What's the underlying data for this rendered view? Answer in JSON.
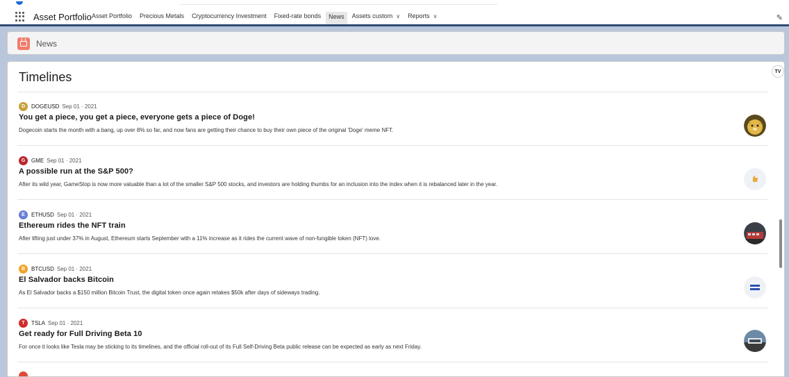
{
  "app": {
    "name": "Asset Portfolio",
    "nav_items": [
      {
        "label": "Asset Portfolio",
        "active": false,
        "dropdown": false
      },
      {
        "label": "Precious Metals",
        "active": false,
        "dropdown": false
      },
      {
        "label": "Cryptocurrency Investment",
        "active": false,
        "dropdown": false
      },
      {
        "label": "Fixed-rate bonds",
        "active": false,
        "dropdown": false
      },
      {
        "label": "News",
        "active": true,
        "dropdown": false
      },
      {
        "label": "Assets custom",
        "active": false,
        "dropdown": true
      },
      {
        "label": "Reports",
        "active": false,
        "dropdown": true
      }
    ]
  },
  "page_header": {
    "title": "News",
    "icon": "tv-icon"
  },
  "feed": {
    "title": "Timelines",
    "logo_text": "TV",
    "items": [
      {
        "symbol": "DOGEUSD",
        "date": "Sep 01 · 2021",
        "icon_letter": "D",
        "icon_color": "#c8a03a",
        "headline": "You get a piece, you get a piece, everyone gets a piece of Doge!",
        "summary": "Dogecoin starts the month with a bang, up over 8% so far, and now fans are getting their chance to buy their own piece of the original 'Doge' meme NFT.",
        "thumb": "doge-thumbnail"
      },
      {
        "symbol": "GME",
        "date": "Sep 01 · 2021",
        "icon_letter": "G",
        "icon_color": "#b8262c",
        "headline": "A possible run at the S&P 500?",
        "summary": "After its wild year, GameStop is now more valuable than a lot of the smaller S&P 500 stocks, and investors are holding thumbs for an inclusion into the index when it is rebalanced later in the year.",
        "thumb": "thumbs-up-thumbnail"
      },
      {
        "symbol": "ETHUSD",
        "date": "Sep 01 · 2021",
        "icon_letter": "E",
        "icon_color": "#6b7fd7",
        "headline": "Ethereum rides the NFT train",
        "summary": "After lifting just under 37% in August, Ethereum starts September with a 11% increase as it rides the current wave of non-fungible token (NFT) love.",
        "thumb": "train-thumbnail"
      },
      {
        "symbol": "BTCUSD",
        "date": "Sep 01 · 2021",
        "icon_letter": "B",
        "icon_color": "#f2a32b",
        "headline": "El Salvador backs Bitcoin",
        "summary": "As El Salvador backs a $150 million Bitcoin Trust, the digital token once again retakes $50k after days of sideways trading.",
        "thumb": "el-salvador-flag-thumbnail"
      },
      {
        "symbol": "TSLA",
        "date": "Sep 01 · 2021",
        "icon_letter": "T",
        "icon_color": "#d12c2c",
        "headline": "Get ready for Full Driving Beta 10",
        "summary": "For once it looks like Tesla may be sticking to its timelines, and the official roll-out of its Full Self-Driving Beta public release can be expected as early as next Friday.",
        "thumb": "car-road-thumbnail"
      }
    ]
  }
}
